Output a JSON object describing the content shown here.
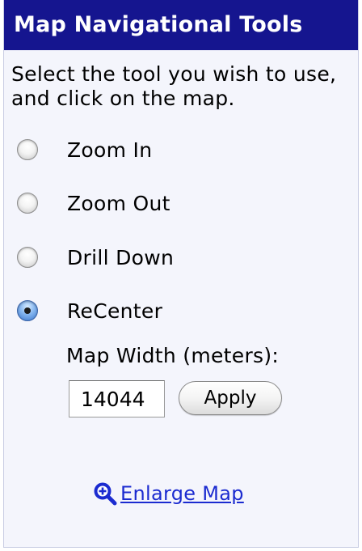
{
  "panel": {
    "title": "Map Navigational Tools",
    "instructions": "Select the tool you wish to use, and click on the map."
  },
  "tools": [
    {
      "label": "Zoom In",
      "checked": false
    },
    {
      "label": "Zoom Out",
      "checked": false
    },
    {
      "label": "Drill Down",
      "checked": false
    },
    {
      "label": "ReCenter",
      "checked": true
    }
  ],
  "recenter": {
    "width_label": "Map Width (meters):",
    "width_value": "14044",
    "apply_label": "Apply"
  },
  "link": {
    "icon": "magnifier-plus-icon",
    "label": "Enlarge Map"
  },
  "colors": {
    "header_bg": "#15158f",
    "header_text": "#ffffff",
    "panel_bg": "#f4f5fc",
    "link": "#1b2bd0"
  }
}
